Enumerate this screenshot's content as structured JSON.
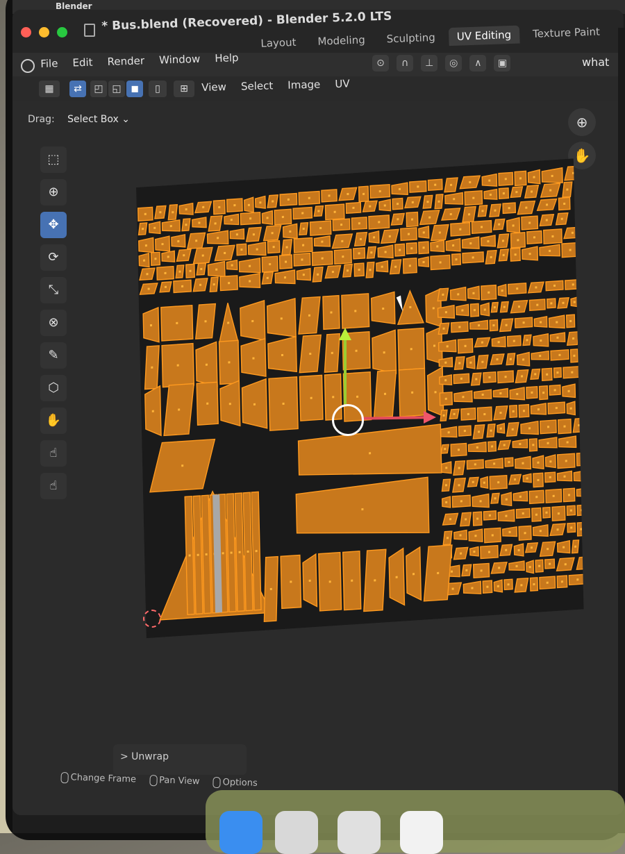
{
  "macos": {
    "app_name": "Blender"
  },
  "window": {
    "title": "* Bus.blend (Recovered) - Blender 5.2.0 LTS",
    "workspace_tabs": [
      {
        "label": "Layout",
        "active": false
      },
      {
        "label": "Modeling",
        "active": false
      },
      {
        "label": "Sculpting",
        "active": false
      },
      {
        "label": "UV Editing",
        "active": true
      },
      {
        "label": "Texture Paint",
        "active": false
      }
    ]
  },
  "menubar": {
    "items": [
      "File",
      "Edit",
      "Render",
      "Window",
      "Help"
    ],
    "right_text": "what"
  },
  "uv_header": {
    "menus": [
      "View",
      "Select",
      "Image",
      "UV"
    ]
  },
  "drag": {
    "label": "Drag:",
    "value": "Select Box"
  },
  "tools": [
    {
      "name": "select-tool-icon",
      "glyph": "⬚",
      "active": false
    },
    {
      "name": "cursor-tool-icon",
      "glyph": "⊕",
      "active": false
    },
    {
      "name": "move-tool-icon",
      "glyph": "✥",
      "active": true
    },
    {
      "name": "rotate-tool-icon",
      "glyph": "⟳",
      "active": false
    },
    {
      "name": "scale-tool-icon",
      "glyph": "⤡",
      "active": false
    },
    {
      "name": "transform-tool-icon",
      "glyph": "⊗",
      "active": false
    },
    {
      "name": "annotate-tool-icon",
      "glyph": "✎",
      "active": false
    },
    {
      "name": "box-tool-icon",
      "glyph": "⬡",
      "active": false
    },
    {
      "name": "grab-tool-icon",
      "glyph": "✋",
      "active": false
    },
    {
      "name": "relax-tool-icon",
      "glyph": "☝",
      "active": false
    },
    {
      "name": "pinch-tool-icon",
      "glyph": "☝",
      "active": false
    }
  ],
  "operator_panel": {
    "label": "> Unwrap"
  },
  "statusbar": [
    "Change Frame",
    "Pan View",
    "Options"
  ],
  "colors": {
    "uv_fill": "#c8781c",
    "uv_edge": "#ff9a1f",
    "uv_bg": "#1a1a1a",
    "active_tool": "#4772b3"
  }
}
